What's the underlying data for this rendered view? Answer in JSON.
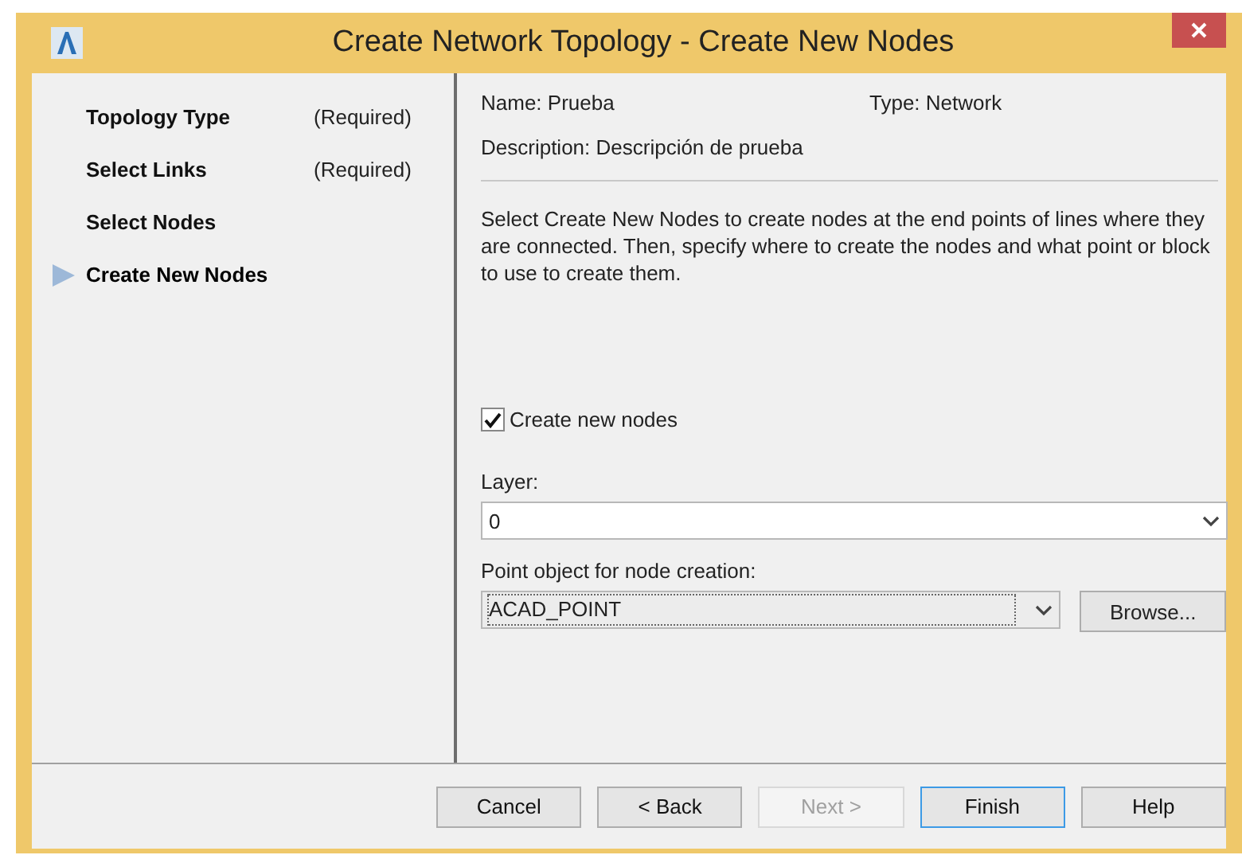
{
  "window": {
    "title": "Create Network Topology - Create New Nodes"
  },
  "steps": [
    {
      "label": "Topology Type",
      "note": "(Required)",
      "selected": false
    },
    {
      "label": "Select Links",
      "note": "(Required)",
      "selected": false
    },
    {
      "label": "Select Nodes",
      "selected": false
    },
    {
      "label": "Create New Nodes",
      "selected": true
    }
  ],
  "info": {
    "name": "Name: Prueba",
    "type": "Type: Network",
    "description": "Description: Descripción de prueba"
  },
  "instructions": "Select Create New Nodes to create nodes at the end points of lines where they are connected. Then, specify where to create the nodes and what point or block to use to create them.",
  "create_nodes": {
    "label": "Create new nodes",
    "checked": true
  },
  "layer": {
    "label": "Layer:",
    "value": "0"
  },
  "point_object": {
    "label": "Point object for node creation:",
    "value": "ACAD_POINT",
    "browse": "Browse..."
  },
  "buttons": [
    {
      "label": "Cancel",
      "disabled": false,
      "default": false
    },
    {
      "label": "< Back",
      "disabled": false,
      "default": false
    },
    {
      "label": "Next >",
      "disabled": true,
      "default": false
    },
    {
      "label": "Finish",
      "disabled": false,
      "default": true
    },
    {
      "label": "Help",
      "disabled": false,
      "default": false
    }
  ]
}
